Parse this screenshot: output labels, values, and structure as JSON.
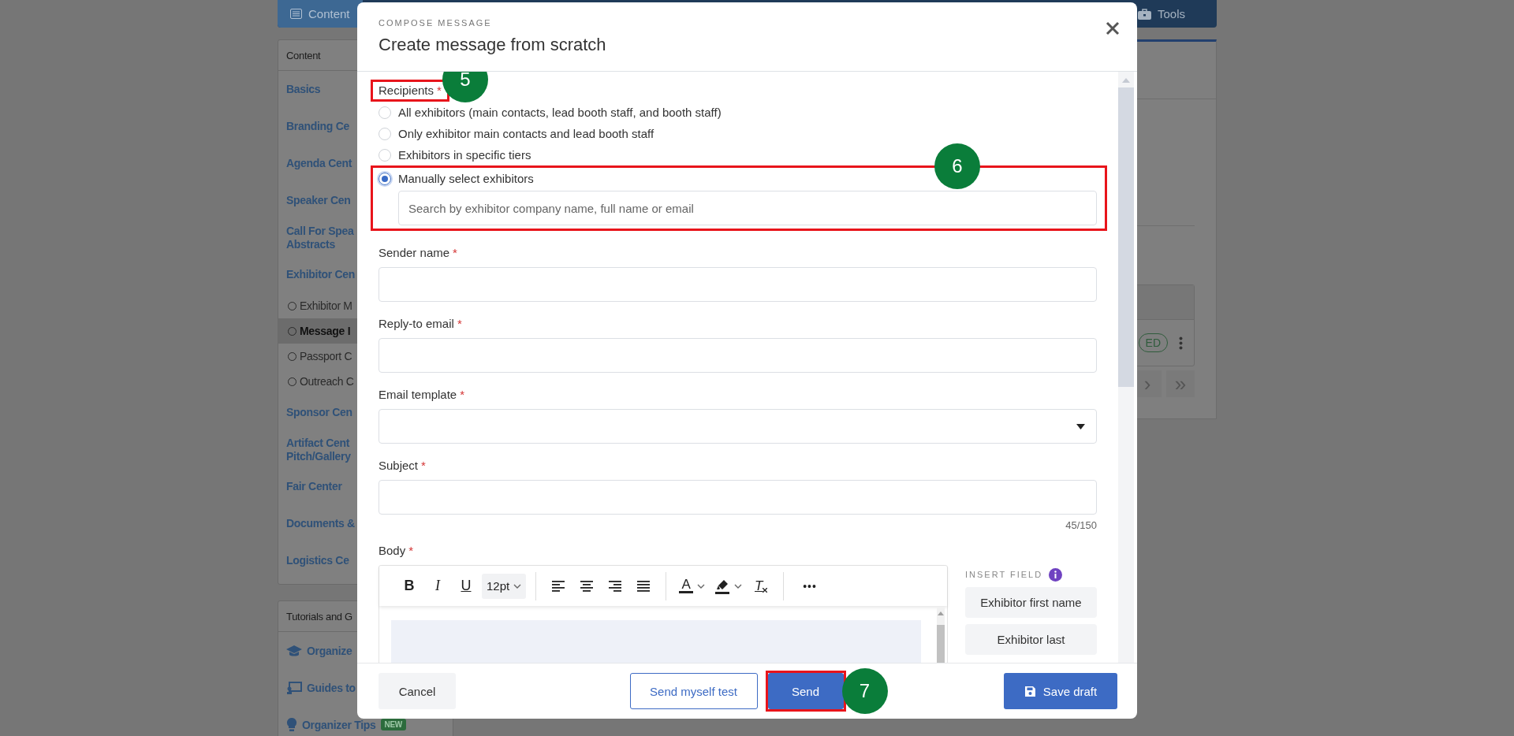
{
  "nav": {
    "left_tab": "Content",
    "right_tab": "Tools"
  },
  "sidebar": {
    "header": "Content",
    "items": [
      {
        "kind": "section",
        "label": "Basics",
        "selected": false
      },
      {
        "kind": "section",
        "label": "Branding Ce",
        "selected": false
      },
      {
        "kind": "section",
        "label": "Agenda Cent",
        "selected": false
      },
      {
        "kind": "section",
        "label": "Speaker Cen",
        "selected": false
      },
      {
        "kind": "section",
        "label": "Call For Spea",
        "label_line_2": "Abstracts",
        "selected": false
      },
      {
        "kind": "section",
        "label": "Exhibitor Cen",
        "selected": false
      },
      {
        "kind": "sub",
        "label": "Exhibitor M",
        "selected": false
      },
      {
        "kind": "sub",
        "label": "Message I",
        "selected": true
      },
      {
        "kind": "sub",
        "label": "Passport C",
        "selected": false
      },
      {
        "kind": "sub",
        "label": "Outreach C",
        "selected": false
      },
      {
        "kind": "section",
        "label": "Sponsor Cen",
        "selected": false
      },
      {
        "kind": "section",
        "label": "Artifact Cent",
        "label_line_2": "Pitch/Gallery",
        "selected": false
      },
      {
        "kind": "section",
        "label": "Fair Center",
        "selected": false
      },
      {
        "kind": "section",
        "label": "Documents &",
        "selected": false
      },
      {
        "kind": "section",
        "label": "Logistics Ce",
        "selected": false
      }
    ]
  },
  "tutorials": {
    "header": "Tutorials and G",
    "items": [
      {
        "kind": "course",
        "label": "Organize"
      },
      {
        "kind": "guide",
        "label": "Guides to"
      },
      {
        "kind": "tip",
        "label": "Organizer Tips",
        "badge": "NEW"
      }
    ]
  },
  "background_table": {
    "status_badge": "ED",
    "pagination": [
      "›",
      "»"
    ]
  },
  "modal": {
    "eyebrow": "COMPOSE MESSAGE",
    "title": "Create message from scratch",
    "recipients": {
      "label": "Recipients",
      "required_mark": "*",
      "highlighted": true,
      "callout": "5",
      "options": [
        {
          "label": "All exhibitors (main contacts, lead booth staff, and booth staff)",
          "selected": false
        },
        {
          "label": "Only exhibitor main contacts and lead booth staff",
          "selected": false
        },
        {
          "label": "Exhibitors in specific tiers",
          "selected": false
        },
        {
          "label": "Manually select exhibitors",
          "selected": true
        }
      ],
      "selection_highlighted": true,
      "selection_callout": "6",
      "search": {
        "placeholder": "Search by exhibitor company name, full name or email"
      }
    },
    "fields": [
      {
        "kind": "text",
        "label": "Sender name",
        "required_mark": "*"
      },
      {
        "kind": "text",
        "label": "Reply-to email",
        "required_mark": "*"
      },
      {
        "kind": "select",
        "label": "Email template",
        "required_mark": "*"
      },
      {
        "kind": "text",
        "label": "Subject",
        "required_mark": "*",
        "counter": "45/150"
      }
    ],
    "body": {
      "label": "Body",
      "required_mark": "*",
      "toolbar": [
        [
          {
            "kind": "bold",
            "label": "B"
          },
          {
            "kind": "italic",
            "label": "I"
          },
          {
            "kind": "underline",
            "label": "U"
          },
          {
            "kind": "size",
            "label": "12pt"
          }
        ],
        [
          {
            "kind": "align-left"
          },
          {
            "kind": "align-center"
          },
          {
            "kind": "align-right"
          },
          {
            "kind": "align-justify"
          }
        ],
        [
          {
            "kind": "text-color",
            "label": "A"
          },
          {
            "kind": "highlight"
          },
          {
            "kind": "clear-format",
            "label": "T"
          }
        ],
        [
          {
            "kind": "more",
            "label": "•••"
          }
        ]
      ],
      "insert_field": {
        "title": "INSERT FIELD",
        "buttons": [
          "Exhibitor first name",
          "Exhibitor last"
        ]
      }
    },
    "footer": [
      {
        "kind": "secondary",
        "label": "Cancel"
      },
      {
        "kind": "outline",
        "label": "Send myself test"
      },
      {
        "kind": "primary",
        "label": "Send",
        "highlighted": true,
        "callout": "7"
      },
      {
        "kind": "save",
        "label": "Save draft"
      }
    ]
  }
}
